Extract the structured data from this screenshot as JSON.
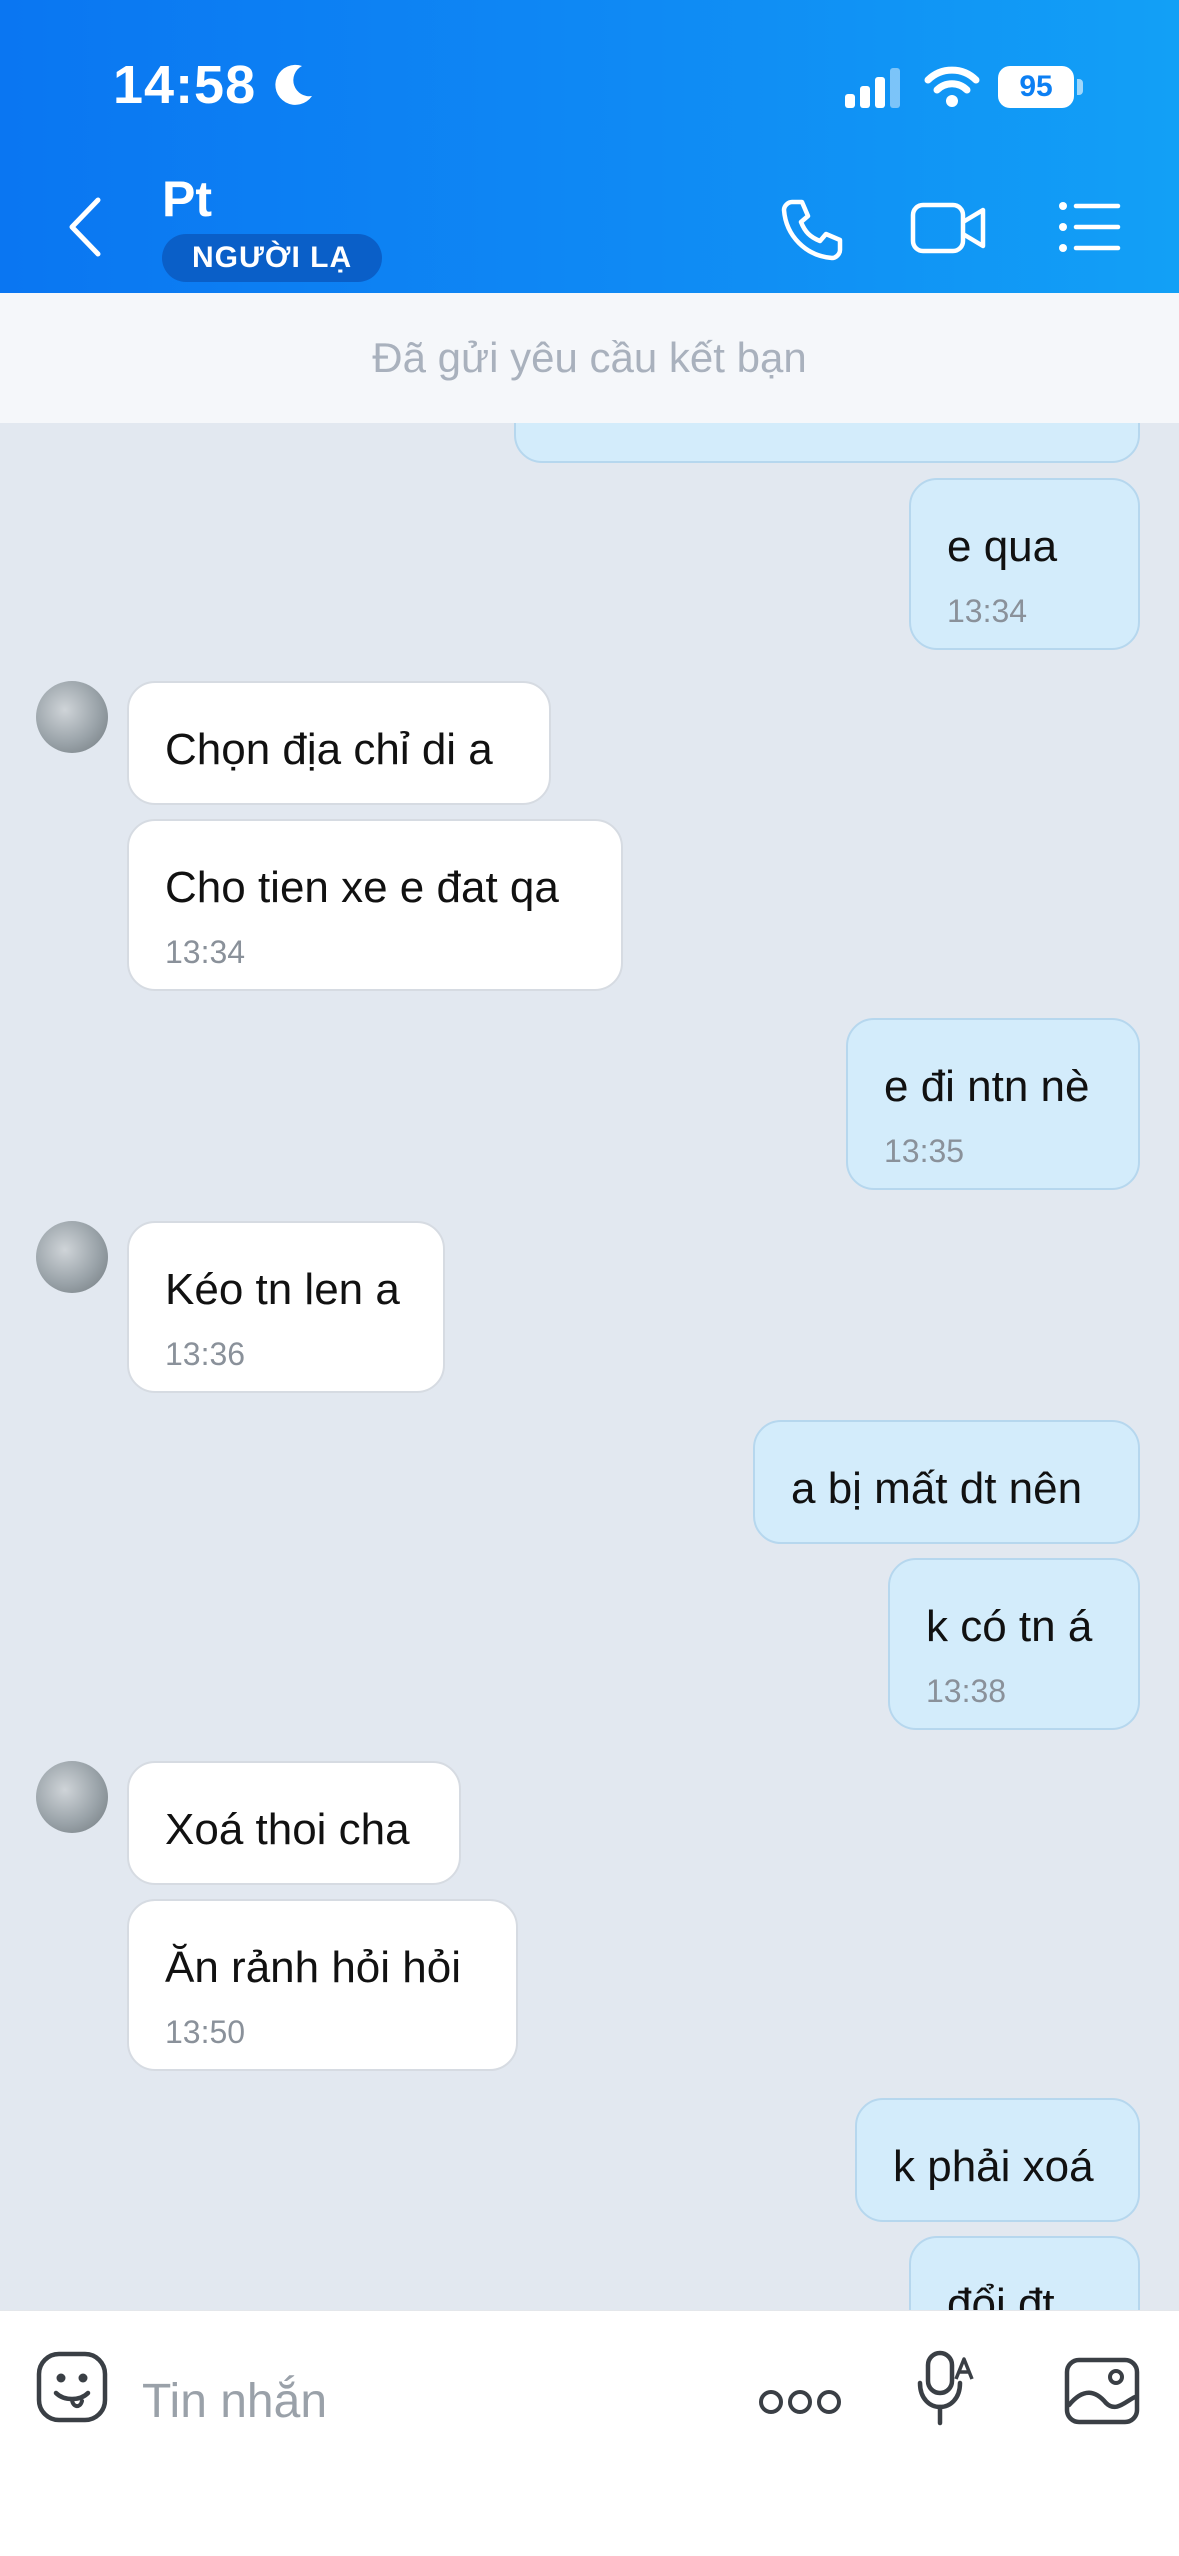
{
  "status_bar": {
    "time": "14:58",
    "battery": "95"
  },
  "header": {
    "name": "Pt",
    "badge": "NGƯỜI LẠ"
  },
  "friend_request": "Đã gửi yêu cầu kết bạn",
  "messages": [
    {
      "from": "me",
      "text": "e qua",
      "time": "13:34"
    },
    {
      "from": "them",
      "text": "Chọn địa chỉ di a",
      "time": ""
    },
    {
      "from": "them",
      "text": "Cho tien xe e đat qa",
      "time": "13:34"
    },
    {
      "from": "me",
      "text": "e đi ntn nè",
      "time": "13:35"
    },
    {
      "from": "them",
      "text": "Kéo tn len a",
      "time": "13:36"
    },
    {
      "from": "me",
      "text": "a bị mất dt nên",
      "time": ""
    },
    {
      "from": "me",
      "text": "k có tn á",
      "time": "13:38"
    },
    {
      "from": "them",
      "text": "Xoá thoi cha",
      "time": ""
    },
    {
      "from": "them",
      "text": "Ăn rảnh hỏi hỏi",
      "time": "13:50"
    },
    {
      "from": "me",
      "text": "k phải xoá",
      "time": ""
    },
    {
      "from": "me",
      "text": "đổi đt",
      "time": ""
    }
  ],
  "input": {
    "placeholder": "Tin nhắn"
  },
  "colors": {
    "header_start": "#0a76f2",
    "header_end": "#12a0f6",
    "my_bubble": "#d3ecfb",
    "their_bubble": "#ffffff",
    "chat_bg": "#e2e8f0"
  }
}
